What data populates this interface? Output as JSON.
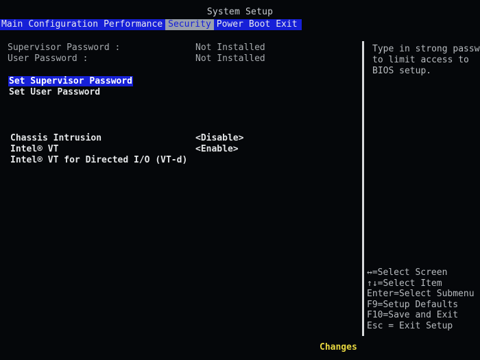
{
  "window": {
    "title": "System Setup"
  },
  "menu": {
    "items": [
      "Main",
      "Configuration",
      "Performance",
      "Security",
      "Power",
      "Boot",
      "Exit"
    ],
    "active": "Security"
  },
  "security": {
    "supervisor_label": "Supervisor Password :",
    "supervisor_value": "Not Installed",
    "user_label": "User Password :",
    "user_value": "Not Installed",
    "set_supervisor": "Set Supervisor Password",
    "set_user": "Set User Password",
    "chassis_label": "Chassis Intrusion",
    "chassis_value": "<Disable>",
    "vt_label": "Intel® VT",
    "vt_value": "<Enable>",
    "vtd_label": "Intel® VT for Directed I/O (VT-d)"
  },
  "help": {
    "lines": [
      "Type in strong password",
      "to limit access to",
      "BIOS setup."
    ]
  },
  "keys": {
    "lines": [
      "↔=Select Screen",
      "↑↓=Select Item",
      "Enter=Select Submenu",
      "F9=Setup Defaults",
      "F10=Save and Exit",
      "Esc = Exit Setup"
    ]
  },
  "footer": {
    "label": "Changes"
  },
  "colors": {
    "background": "#05070a",
    "menubar": "#1620d8",
    "active_tab": "#9aa0ae",
    "footer": "#e8d840"
  }
}
